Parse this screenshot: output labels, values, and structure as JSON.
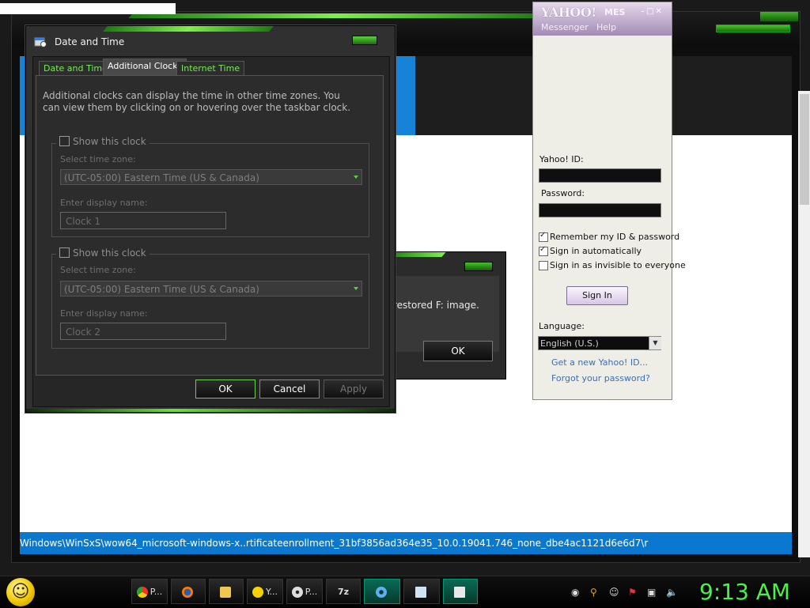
{
  "date_time_dialog": {
    "title": "Date and Time",
    "tabs": [
      "Date and Time",
      "Additional Clocks",
      "Internet Time"
    ],
    "active_tab": "Additional Clocks",
    "description": "Additional clocks can display the time in other time zones. You can view them by clicking on or hovering over the taskbar clock.",
    "clock1": {
      "show_label": "Show this clock",
      "checked": false,
      "timezone_label": "Select time zone:",
      "timezone_value": "(UTC-05:00) Eastern Time (US & Canada)",
      "display_name_label": "Enter display name:",
      "display_name_value": "Clock 1"
    },
    "clock2": {
      "show_label": "Show this clock",
      "checked": false,
      "timezone_label": "Select time zone:",
      "timezone_value": "(UTC-05:00) Eastern Time (US & Canada)",
      "display_name_label": "Enter display name:",
      "display_name_value": "Clock 2"
    },
    "buttons": {
      "ok": "OK",
      "cancel": "Cancel",
      "apply": "Apply"
    }
  },
  "message_dialog": {
    "text": "restored F: image.",
    "ok": "OK"
  },
  "background_window": {
    "status_path": "Windows\\WinSxS\\wow64_microsoft-windows-x..rtificateenrollment_31bf3856ad364e35_10.0.19041.746_none_dbe4ac1121d6e6d7\\r"
  },
  "yahoo_messenger": {
    "logo": "YAHOO!",
    "logo_small": "MES",
    "menu": {
      "messenger": "Messenger",
      "help": "Help"
    },
    "yahoo_id_label": "Yahoo! ID:",
    "yahoo_id_value": "",
    "password_label": "Password:",
    "remember_label": "Remember my ID & password",
    "remember_checked": true,
    "auto_label": "Sign in automatically",
    "auto_checked": true,
    "invisible_label": "Sign in as invisible to everyone",
    "invisible_checked": false,
    "sign_in_button": "Sign In",
    "language_label": "Language:",
    "language_value": "English (U.S.)",
    "new_id_link": "Get a new Yahoo! ID...",
    "forgot_link": "Forgot your password?"
  },
  "taskbar": {
    "buttons": [
      {
        "label": "P...",
        "icon": "chrome-icon"
      },
      {
        "label": "",
        "icon": "firefox-icon"
      },
      {
        "label": "",
        "icon": "folder-icon"
      },
      {
        "label": "Y...",
        "icon": "yahoo-smiley-icon"
      },
      {
        "label": "P...",
        "icon": "disc-icon"
      },
      {
        "label": "7z",
        "icon": "7zip-icon"
      },
      {
        "label": "",
        "icon": "gear-icon"
      },
      {
        "label": "",
        "icon": "notepad-icon"
      },
      {
        "label": "",
        "icon": "control-panel-icon"
      }
    ],
    "clock": "9:13 AM",
    "accent": "#4cf04c"
  },
  "colors": {
    "green_accent": "#5bd43a",
    "status_blue": "#0b78d0",
    "yahoo_purple": "#a28bb5"
  }
}
